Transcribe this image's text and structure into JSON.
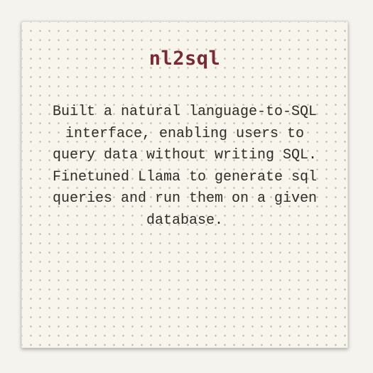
{
  "card": {
    "title": "nl2sql",
    "description_1": "Built a natural language-to-SQL interface, enabling users to query data without writing SQL.",
    "description_2": "Finetuned Llama to generate sql queries and run them on a given database."
  },
  "colors": {
    "page_background": "#f4f3ee",
    "card_background": "#f7f5ec",
    "dot_grid": "#bdb8a6",
    "title": "#7a2a35",
    "body_text": "#2f2c28"
  }
}
